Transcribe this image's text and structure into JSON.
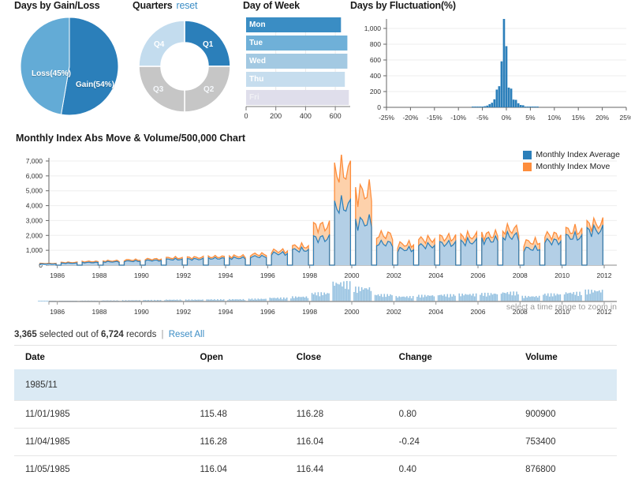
{
  "colors": {
    "blue_dark": "#2b7fba",
    "blue_mid": "#4f9fd0",
    "blue_light": "#a7cde4",
    "blue_pale": "#cfe2f0",
    "blue_faint": "#dfe3ef",
    "grey": "#c6c6c6",
    "orange": "#fd8d3c",
    "area_fill": "#b0cde4",
    "link": "#3c8dc5",
    "grid": "#eeeeee",
    "axis": "#999999",
    "row_highlight": "#dbeaf4"
  },
  "gainloss": {
    "title": "Days by Gain/Loss",
    "chart_data": {
      "type": "pie",
      "title": "Days by Gain/Loss",
      "labels": [
        "Gain(54%)",
        "Loss(45%)"
      ],
      "values": [
        54,
        45
      ],
      "colors": [
        "#2b7fba",
        "#63abd6"
      ],
      "legend": "none"
    }
  },
  "quarters": {
    "title": "Quarters",
    "reset_label": "reset",
    "chart_data": {
      "type": "pie",
      "title": "Quarters",
      "donut": true,
      "labels": [
        "Q1",
        "Q2",
        "Q3",
        "Q4"
      ],
      "values": [
        25,
        25,
        25,
        25
      ],
      "colors": [
        "#2b7fba",
        "#c6c6c6",
        "#c6c6c6",
        "#c3dcee"
      ],
      "legend": "none"
    }
  },
  "dayofweek": {
    "title": "Day of Week",
    "chart_data": {
      "type": "bar",
      "orientation": "horizontal",
      "title": "Day of Week",
      "categories": [
        "Mon",
        "Tue",
        "Wed",
        "Thu",
        "Fri"
      ],
      "values": [
        638,
        681,
        681,
        664,
        691
      ],
      "colors": [
        "#3a8dc4",
        "#6fb0d8",
        "#a3c9e2",
        "#c6ddee",
        "#dfdeeb"
      ],
      "xlabel": "",
      "ylabel": "",
      "xlim": [
        0,
        700
      ],
      "xticks": [
        0,
        200,
        400,
        600
      ],
      "xticklabels": [
        "0",
        "200",
        "400",
        "600"
      ],
      "grid": true
    }
  },
  "fluctuation": {
    "title": "Days by Fluctuation(%)",
    "chart_data": {
      "type": "bar",
      "title": "Days by Fluctuation(%)",
      "xlabel": "",
      "ylabel": "",
      "xlim": [
        -25,
        25
      ],
      "ylim": [
        0,
        1100
      ],
      "xticks": [
        -25,
        -20,
        -15,
        -10,
        -5,
        0,
        5,
        10,
        15,
        20,
        25
      ],
      "xticklabels": [
        "-25%",
        "-20%",
        "-15%",
        "-10%",
        "-5%",
        "0%",
        "5%",
        "10%",
        "15%",
        "20%",
        "25%"
      ],
      "yticks": [
        0,
        200,
        400,
        600,
        800,
        1000
      ],
      "yticklabels": [
        "0",
        "200",
        "400",
        "600",
        "800",
        "1,000"
      ],
      "grid": true,
      "bar_color": "#2b7fba",
      "x": [
        -7.0,
        -6.5,
        -6.0,
        -5.5,
        -5.0,
        -4.5,
        -4.0,
        -3.5,
        -3.0,
        -2.5,
        -2.0,
        -1.5,
        -1.0,
        -0.5,
        0.0,
        0.5,
        1.0,
        1.5,
        2.0,
        2.5,
        3.0,
        3.5,
        4.0,
        4.5,
        5.0,
        5.5,
        6.0,
        6.5
      ],
      "values": [
        4,
        3,
        5,
        7,
        8,
        14,
        22,
        40,
        58,
        102,
        225,
        268,
        583,
        1120,
        775,
        250,
        237,
        98,
        95,
        52,
        30,
        26,
        10,
        8,
        6,
        4,
        3,
        2
      ]
    }
  },
  "mainchart": {
    "title": "Monthly Index Abs Move & Volume/500,000 Chart",
    "legend": [
      {
        "label": "Monthly Index Average",
        "color": "#2b7fba"
      },
      {
        "label": "Monthly Index Move",
        "color": "#fd8d3c"
      }
    ],
    "hint": "select a time range to zoom in",
    "chart_data": {
      "type": "area",
      "title": "Monthly Index Abs Move & Volume/500,000 Chart",
      "xlabel": "",
      "ylabel": "",
      "ylim": [
        0,
        7000
      ],
      "yticks": [
        0,
        1000,
        2000,
        3000,
        4000,
        5000,
        6000,
        7000
      ],
      "yticklabels": [
        "0",
        "1,000",
        "2,000",
        "3,000",
        "4,000",
        "5,000",
        "6,000",
        "7,000"
      ],
      "xlim": [
        "1985",
        "2012"
      ],
      "xticks": [
        1986,
        1988,
        1990,
        1992,
        1994,
        1996,
        1998,
        2000,
        2002,
        2004,
        2006,
        2008,
        2010,
        2012
      ],
      "xticklabels": [
        "1986",
        "1988",
        "1990",
        "1992",
        "1994",
        "1996",
        "1998",
        "2000",
        "2002",
        "2004",
        "2006",
        "2008",
        "2010",
        "2012"
      ],
      "grid": true,
      "series": [
        {
          "name": "Monthly Index Average",
          "color": "#2b7fba",
          "fill": "#b0cde4",
          "x": [
            1985.9,
            1986.5,
            1987.0,
            1987.5,
            1988.0,
            1988.5,
            1989.0,
            1989.5,
            1990.0,
            1990.5,
            1991.0,
            1991.5,
            1992.0,
            1992.5,
            1993.0,
            1993.5,
            1994.0,
            1994.5,
            1995.0,
            1995.5,
            1996.0,
            1996.5,
            1997.0,
            1997.5,
            1998.0,
            1998.5,
            1999.0,
            1999.5,
            2000.0,
            2000.5,
            2001.0,
            2001.5,
            2002.0,
            2002.5,
            2003.0,
            2003.5,
            2004.0,
            2004.5,
            2005.0,
            2005.5,
            2006.0,
            2006.5,
            2007.0,
            2007.5,
            2008.0,
            2008.5,
            2009.0,
            2009.5,
            2010.0,
            2010.5,
            2011.0,
            2011.5,
            2012.0
          ],
          "values": [
            90,
            120,
            150,
            180,
            200,
            230,
            250,
            280,
            300,
            330,
            350,
            400,
            430,
            470,
            450,
            490,
            500,
            520,
            530,
            600,
            640,
            740,
            870,
            1050,
            1130,
            1400,
            2000,
            2100,
            4400,
            4200,
            3200,
            2000,
            1620,
            1500,
            1180,
            1320,
            1450,
            1560,
            1600,
            1680,
            1730,
            1800,
            1880,
            1950,
            2150,
            2250,
            1230,
            1600,
            1770,
            1920,
            2100,
            2200,
            2580
          ]
        },
        {
          "name": "Monthly Index Move",
          "color": "#fd8d3c",
          "fill": "#fdbe85",
          "x": [
            1985.9,
            1986.5,
            1987.0,
            1987.5,
            1988.0,
            1988.5,
            1989.0,
            1989.5,
            1990.0,
            1990.5,
            1991.0,
            1991.5,
            1992.0,
            1992.5,
            1993.0,
            1993.5,
            1994.0,
            1994.5,
            1995.0,
            1995.5,
            1996.0,
            1996.5,
            1997.0,
            1997.5,
            1998.0,
            1998.5,
            1999.0,
            1999.5,
            2000.0,
            2000.5,
            2001.0,
            2001.5,
            2002.0,
            2002.5,
            2003.0,
            2003.5,
            2004.0,
            2004.5,
            2005.0,
            2005.5,
            2006.0,
            2006.5,
            2007.0,
            2007.5,
            2008.0,
            2008.5,
            2009.0,
            2009.5,
            2010.0,
            2010.5,
            2011.0,
            2011.5,
            2012.0
          ],
          "values": [
            130,
            170,
            205,
            235,
            270,
            300,
            320,
            360,
            390,
            420,
            450,
            505,
            545,
            590,
            570,
            615,
            625,
            650,
            665,
            760,
            810,
            920,
            1060,
            1270,
            1400,
            1720,
            2900,
            2750,
            7000,
            5800,
            5400,
            2700,
            2250,
            2050,
            1550,
            1750,
            1920,
            2050,
            2050,
            2100,
            2150,
            2200,
            2260,
            2300,
            2650,
            2600,
            1730,
            2100,
            2230,
            2400,
            2580,
            2700,
            3050
          ]
        }
      ]
    }
  },
  "navigator": {
    "hint": "select a time range to zoom in",
    "chart_data": {
      "type": "bar",
      "xticks": [
        1986,
        1988,
        1990,
        1992,
        1994,
        1996,
        1998,
        2000,
        2002,
        2004,
        2006,
        2008,
        2010,
        2012
      ],
      "xticklabels": [
        "1986",
        "1988",
        "1990",
        "1992",
        "1994",
        "1996",
        "1998",
        "2000",
        "2002",
        "2004",
        "2006",
        "2008",
        "2010",
        "2012"
      ],
      "bar_color": "#93c0e0"
    }
  },
  "records": {
    "selected": "3,365",
    "selected_suffix": "selected out of",
    "total": "6,724",
    "total_suffix": "records",
    "separator": "|",
    "reset_all": "Reset All"
  },
  "table": {
    "columns": [
      "Date",
      "Open",
      "Close",
      "Change",
      "Volume"
    ],
    "rows": [
      {
        "type": "group",
        "label": "1985/11"
      },
      {
        "type": "data",
        "cells": [
          "11/01/1985",
          "115.48",
          "116.28",
          "0.80",
          "900900"
        ]
      },
      {
        "type": "data",
        "cells": [
          "11/04/1985",
          "116.28",
          "116.04",
          "-0.24",
          "753400"
        ]
      },
      {
        "type": "data",
        "cells": [
          "11/05/1985",
          "116.04",
          "116.44",
          "0.40",
          "876800"
        ]
      }
    ]
  }
}
